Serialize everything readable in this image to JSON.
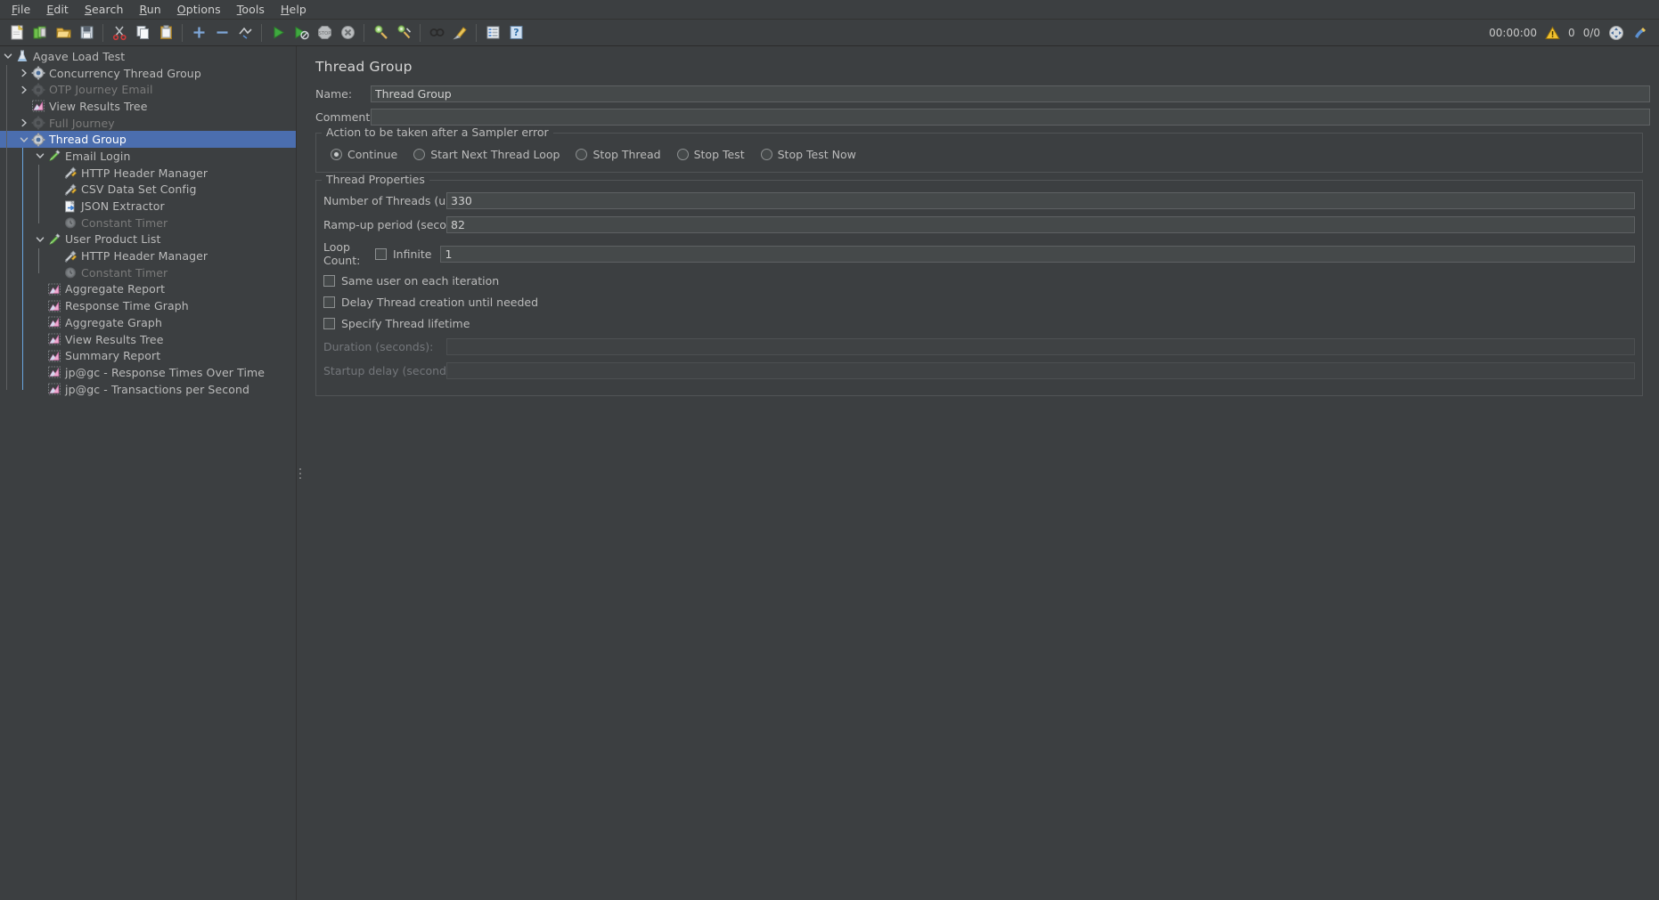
{
  "menubar": {
    "items": [
      {
        "label": "File",
        "accel": "F"
      },
      {
        "label": "Edit",
        "accel": "E"
      },
      {
        "label": "Search",
        "accel": "S"
      },
      {
        "label": "Run",
        "accel": "R"
      },
      {
        "label": "Options",
        "accel": "O"
      },
      {
        "label": "Tools",
        "accel": "T"
      },
      {
        "label": "Help",
        "accel": "H"
      }
    ]
  },
  "toolbar": {
    "buttons": [
      {
        "name": "new-icon",
        "title": "New"
      },
      {
        "name": "templates-icon",
        "title": "Templates"
      },
      {
        "name": "open-icon",
        "title": "Open"
      },
      {
        "name": "save-icon",
        "title": "Save"
      },
      {
        "name": "cut-icon",
        "title": "Cut"
      },
      {
        "name": "copy-icon",
        "title": "Copy"
      },
      {
        "name": "paste-icon",
        "title": "Paste"
      },
      {
        "name": "expand-all-icon",
        "title": "Expand All"
      },
      {
        "name": "collapse-all-icon",
        "title": "Collapse All"
      },
      {
        "name": "toggle-icon",
        "title": "Toggle"
      },
      {
        "name": "start-icon",
        "title": "Start"
      },
      {
        "name": "start-no-timers-icon",
        "title": "Start no pauses"
      },
      {
        "name": "stop-icon",
        "title": "Stop"
      },
      {
        "name": "shutdown-icon",
        "title": "Shutdown"
      },
      {
        "name": "clear-icon",
        "title": "Clear"
      },
      {
        "name": "clear-all-icon",
        "title": "Clear All"
      },
      {
        "name": "search-icon",
        "title": "Search"
      },
      {
        "name": "reset-search-icon",
        "title": "Reset Search"
      },
      {
        "name": "function-helper-icon",
        "title": "Function Helper Dialog"
      },
      {
        "name": "help-icon",
        "title": "Help"
      }
    ],
    "status": {
      "elapsed": "00:00:00",
      "warning_count": "0",
      "threads": "0/0"
    }
  },
  "tree": {
    "nodes": [
      {
        "label": "Agave Load Test",
        "depth": 0,
        "icon": "test-plan-icon",
        "toggle": "expanded",
        "selected": false,
        "disabled": false
      },
      {
        "label": "Concurrency Thread Group",
        "depth": 1,
        "icon": "thread-group-icon",
        "toggle": "collapsed",
        "selected": false,
        "disabled": false
      },
      {
        "label": "OTP Journey Email",
        "depth": 1,
        "icon": "thread-group-icon",
        "toggle": "collapsed",
        "selected": false,
        "disabled": true
      },
      {
        "label": "View Results Tree",
        "depth": 1,
        "icon": "listener-icon",
        "toggle": "none",
        "selected": false,
        "disabled": false
      },
      {
        "label": "Full Journey",
        "depth": 1,
        "icon": "thread-group-icon",
        "toggle": "collapsed",
        "selected": false,
        "disabled": true
      },
      {
        "label": "Thread Group",
        "depth": 1,
        "icon": "thread-group-icon",
        "toggle": "expanded",
        "selected": true,
        "disabled": false
      },
      {
        "label": "Email Login",
        "depth": 2,
        "icon": "sampler-icon",
        "toggle": "expanded",
        "selected": false,
        "disabled": false
      },
      {
        "label": "HTTP Header Manager",
        "depth": 3,
        "icon": "config-icon",
        "toggle": "none",
        "selected": false,
        "disabled": false
      },
      {
        "label": "CSV Data Set Config",
        "depth": 3,
        "icon": "config-icon",
        "toggle": "none",
        "selected": false,
        "disabled": false
      },
      {
        "label": "JSON Extractor",
        "depth": 3,
        "icon": "extractor-icon",
        "toggle": "none",
        "selected": false,
        "disabled": false
      },
      {
        "label": "Constant Timer",
        "depth": 3,
        "icon": "timer-icon",
        "toggle": "none",
        "selected": false,
        "disabled": true
      },
      {
        "label": "User Product List",
        "depth": 2,
        "icon": "sampler-icon",
        "toggle": "expanded",
        "selected": false,
        "disabled": false
      },
      {
        "label": "HTTP Header Manager",
        "depth": 3,
        "icon": "config-icon",
        "toggle": "none",
        "selected": false,
        "disabled": false
      },
      {
        "label": "Constant Timer",
        "depth": 3,
        "icon": "timer-icon",
        "toggle": "none",
        "selected": false,
        "disabled": true
      },
      {
        "label": "Aggregate Report",
        "depth": 2,
        "icon": "listener-icon",
        "toggle": "none",
        "selected": false,
        "disabled": false
      },
      {
        "label": "Response Time Graph",
        "depth": 2,
        "icon": "listener-icon",
        "toggle": "none",
        "selected": false,
        "disabled": false
      },
      {
        "label": "Aggregate Graph",
        "depth": 2,
        "icon": "listener-icon",
        "toggle": "none",
        "selected": false,
        "disabled": false
      },
      {
        "label": "View Results Tree",
        "depth": 2,
        "icon": "listener-icon",
        "toggle": "none",
        "selected": false,
        "disabled": false
      },
      {
        "label": "Summary Report",
        "depth": 2,
        "icon": "listener-icon",
        "toggle": "none",
        "selected": false,
        "disabled": false
      },
      {
        "label": "jp@gc - Response Times Over Time",
        "depth": 2,
        "icon": "listener-icon",
        "toggle": "none",
        "selected": false,
        "disabled": false
      },
      {
        "label": "jp@gc - Transactions per Second",
        "depth": 2,
        "icon": "listener-icon",
        "toggle": "none",
        "selected": false,
        "disabled": false
      }
    ]
  },
  "panel": {
    "title": "Thread Group",
    "name_label": "Name:",
    "name_value": "Thread Group",
    "comments_label": "Comments:",
    "comments_value": "",
    "comments_placeholder": "",
    "sampler_error": {
      "group_title": "Action to be taken after a Sampler error",
      "options": [
        {
          "label": "Continue",
          "checked": true
        },
        {
          "label": "Start Next Thread Loop",
          "checked": false
        },
        {
          "label": "Stop Thread",
          "checked": false
        },
        {
          "label": "Stop Test",
          "checked": false
        },
        {
          "label": "Stop Test Now",
          "checked": false
        }
      ]
    },
    "thread_properties": {
      "group_title": "Thread Properties",
      "threads_label": "Number of Threads (users):",
      "threads_value": "330",
      "rampup_label": "Ramp-up period (seconds):",
      "rampup_value": "82",
      "loop_label": "Loop Count:",
      "loop_infinite_label": "Infinite",
      "loop_infinite_checked": false,
      "loop_value": "1",
      "same_user_label": "Same user on each iteration",
      "same_user_checked": false,
      "delay_thread_label": "Delay Thread creation until needed",
      "delay_thread_checked": false,
      "specify_lifetime_label": "Specify Thread lifetime",
      "specify_lifetime_checked": false,
      "duration_label": "Duration (seconds):",
      "duration_value": "",
      "startup_delay_label": "Startup delay (seconds):",
      "startup_delay_value": ""
    }
  },
  "colors": {
    "background": "#3c3f41",
    "selection": "#4b6eaf",
    "text": "#bbbbbb",
    "text_disabled": "#7a7a7a",
    "field_bg": "#45494a",
    "border": "#5e6163"
  }
}
